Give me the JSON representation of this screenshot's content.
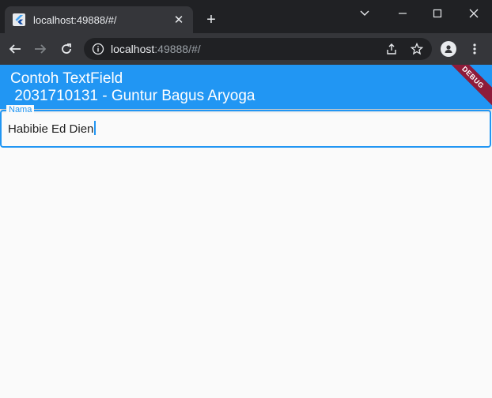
{
  "browser": {
    "tab": {
      "title": "localhost:49888/#/",
      "close_glyph": "✕"
    },
    "new_tab_glyph": "+",
    "address": {
      "host": "localhost",
      "rest": ":49888/#/"
    },
    "icons": {
      "favicon": "flutter-icon",
      "back": "back-arrow-icon",
      "forward": "forward-arrow-icon",
      "reload": "reload-icon",
      "info": "info-icon",
      "share": "share-icon",
      "bookmark": "star-icon",
      "profile": "profile-icon",
      "menu": "kebab-menu-icon"
    }
  },
  "app": {
    "title_line1": "Contoh TextField",
    "title_line2": " 2031710131 - Guntur Bagus Aryoga",
    "debug_banner": "DEBUG",
    "textfield": {
      "label": "Nama",
      "value": "Habibie Ed Dien"
    },
    "colors": {
      "primary": "#2196f3",
      "banner": "#8e1b3a",
      "background": "#fafafa"
    }
  }
}
